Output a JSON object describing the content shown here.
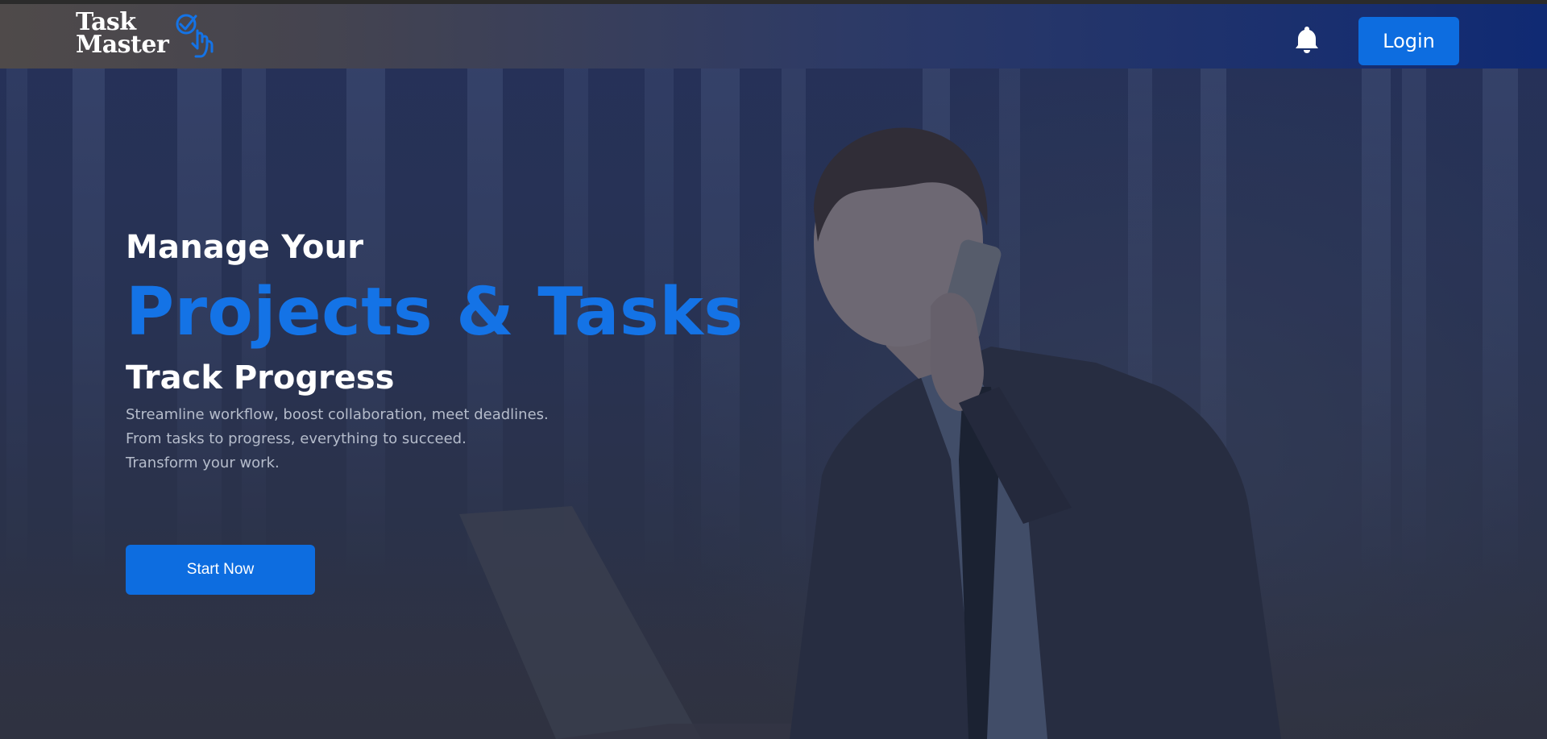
{
  "header": {
    "logo_line1": "Task",
    "logo_line2": "Master",
    "login_label": "Login",
    "icons": [
      "checkmark-hand-logo-icon",
      "bell-icon"
    ]
  },
  "hero": {
    "line1": "Manage Your",
    "line2": "Projects & Tasks",
    "line3": "Track Progress",
    "description": [
      "Streamline workflow, boost collaboration, meet deadlines.",
      "From tasks to progress, everything to succeed.",
      "Transform your work."
    ],
    "cta_label": "Start Now"
  },
  "colors": {
    "accent": "#0d6de0",
    "headline_blue": "#1473e6",
    "header_dark": "#102a73"
  }
}
